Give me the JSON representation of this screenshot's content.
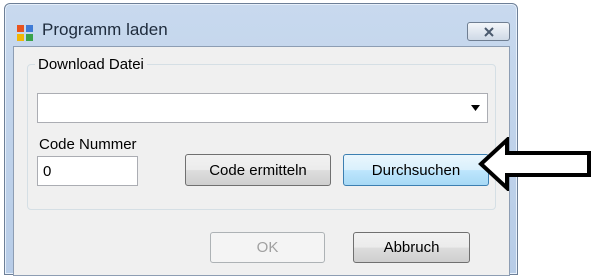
{
  "window": {
    "title": "Programm laden",
    "icons": {
      "app": "app-window-icon",
      "close": "close-x-icon"
    }
  },
  "download_group": {
    "label": "Download Datei",
    "file_combo": {
      "value": "",
      "icon": "chevron-down-icon"
    }
  },
  "code": {
    "label": "Code Nummer",
    "value": "0"
  },
  "buttons": {
    "determine_code": "Code ermitteln",
    "browse": "Durchsuchen",
    "ok": "OK",
    "cancel": "Abbruch"
  },
  "annotation": {
    "icon": "pointer-arrow-icon"
  },
  "colors": {
    "titlebar": "#b7cce7",
    "client_bg": "#f0f0f0",
    "browse_highlight": "#bee6fd",
    "disabled_text": "#a0a0a0"
  }
}
